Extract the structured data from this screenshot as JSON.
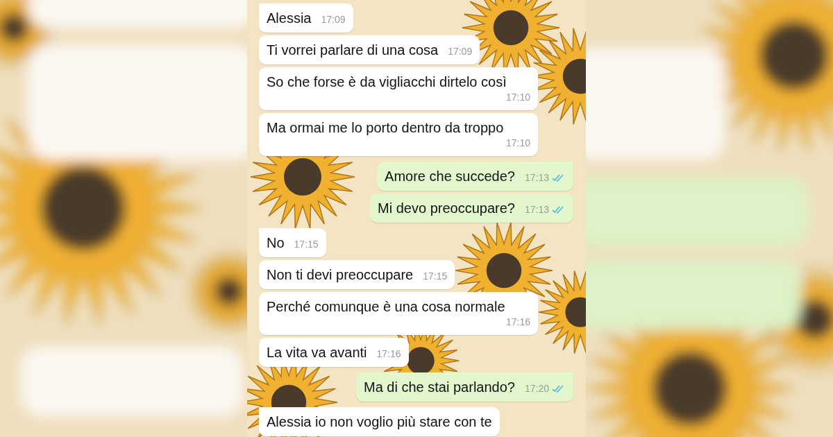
{
  "messages": [
    {
      "text": "Alessia",
      "time": "17:09",
      "outgoing": false
    },
    {
      "text": "Ti vorrei parlare di una cosa",
      "time": "17:09",
      "outgoing": false
    },
    {
      "text": "So che forse è da vigliacchi dirtelo così",
      "time": "17:10",
      "outgoing": false
    },
    {
      "text": "Ma ormai me lo porto dentro da troppo",
      "time": "17:10",
      "outgoing": false
    },
    {
      "text": "Amore che succede?",
      "time": "17:13",
      "outgoing": true,
      "read": true
    },
    {
      "text": "Mi devo preoccupare?",
      "time": "17:13",
      "outgoing": true,
      "read": true
    },
    {
      "text": "No",
      "time": "17:15",
      "outgoing": false
    },
    {
      "text": "Non ti devi preoccupare",
      "time": "17:15",
      "outgoing": false
    },
    {
      "text": "Perché comunque è una cosa normale",
      "time": "17:16",
      "outgoing": false
    },
    {
      "text": "La vita va avanti",
      "time": "17:16",
      "outgoing": false
    },
    {
      "text": "Ma di che stai parlando?",
      "time": "17:20",
      "outgoing": true,
      "read": true
    },
    {
      "text": "Alessia io non voglio più stare con te",
      "outgoing": false
    }
  ]
}
